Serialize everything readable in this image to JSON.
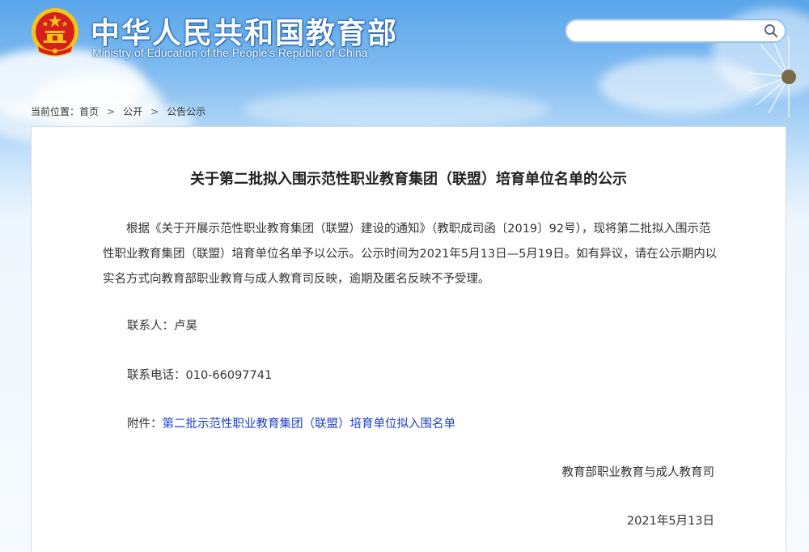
{
  "header": {
    "title_cn": "中华人民共和国教育部",
    "title_en": "Ministry of Education of the People's Republic of China",
    "search_placeholder": ""
  },
  "breadcrumb": {
    "prefix": "当前位置：",
    "items": [
      "首页",
      "公开",
      "公告公示"
    ],
    "separator": ">"
  },
  "article": {
    "title": "关于第二批拟入围示范性职业教育集团（联盟）培育单位名单的公示",
    "paragraph": "根据《关于开展示范性职业教育集团（联盟）建设的通知》（教职成司函〔2019〕92号），现将第二批拟入围示范性职业教育集团（联盟）培育单位名单予以公示。公示时间为2021年5月13日—5月19日。如有异议，请在公示期内以实名方式向教育部职业教育与成人教育司反映，逾期及匿名反映不予受理。",
    "contact_label": "联系人：",
    "contact_name": "卢昊",
    "phone_label": "联系电话：",
    "phone": "010-66097741",
    "attachment_label": "附件：",
    "attachment_link": "第二批示范性职业教育集团（联盟）培育单位拟入围名单",
    "department": "教育部职业教育与成人教育司",
    "date": "2021年5月13日"
  },
  "colors": {
    "sky_top": "#5aa6ea",
    "emblem_red": "#d6201c",
    "emblem_gold": "#f5c518",
    "link": "#1a3fc8"
  },
  "icons": {
    "emblem": "national-emblem-icon",
    "search": "search-icon"
  }
}
